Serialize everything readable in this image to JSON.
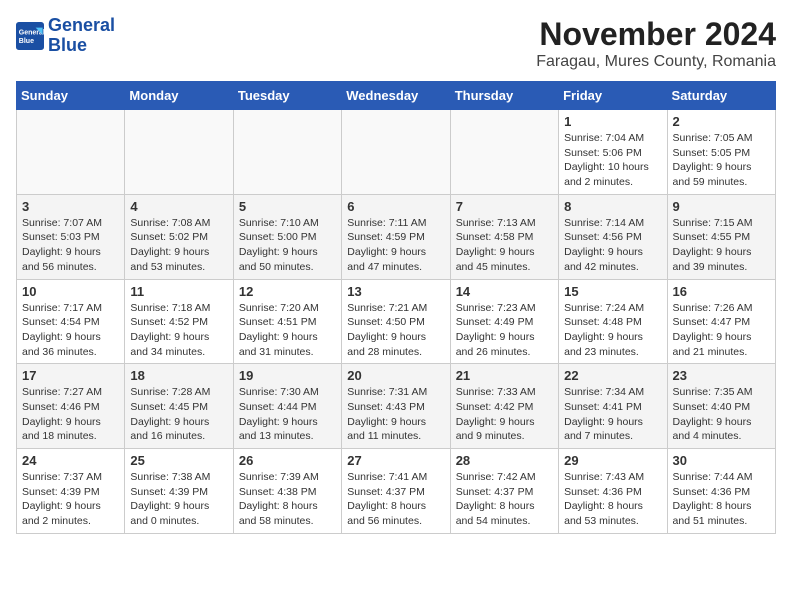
{
  "header": {
    "logo_line1": "General",
    "logo_line2": "Blue",
    "month": "November 2024",
    "location": "Faragau, Mures County, Romania"
  },
  "weekdays": [
    "Sunday",
    "Monday",
    "Tuesday",
    "Wednesday",
    "Thursday",
    "Friday",
    "Saturday"
  ],
  "weeks": [
    [
      {
        "day": "",
        "info": ""
      },
      {
        "day": "",
        "info": ""
      },
      {
        "day": "",
        "info": ""
      },
      {
        "day": "",
        "info": ""
      },
      {
        "day": "",
        "info": ""
      },
      {
        "day": "1",
        "info": "Sunrise: 7:04 AM\nSunset: 5:06 PM\nDaylight: 10 hours\nand 2 minutes."
      },
      {
        "day": "2",
        "info": "Sunrise: 7:05 AM\nSunset: 5:05 PM\nDaylight: 9 hours\nand 59 minutes."
      }
    ],
    [
      {
        "day": "3",
        "info": "Sunrise: 7:07 AM\nSunset: 5:03 PM\nDaylight: 9 hours\nand 56 minutes."
      },
      {
        "day": "4",
        "info": "Sunrise: 7:08 AM\nSunset: 5:02 PM\nDaylight: 9 hours\nand 53 minutes."
      },
      {
        "day": "5",
        "info": "Sunrise: 7:10 AM\nSunset: 5:00 PM\nDaylight: 9 hours\nand 50 minutes."
      },
      {
        "day": "6",
        "info": "Sunrise: 7:11 AM\nSunset: 4:59 PM\nDaylight: 9 hours\nand 47 minutes."
      },
      {
        "day": "7",
        "info": "Sunrise: 7:13 AM\nSunset: 4:58 PM\nDaylight: 9 hours\nand 45 minutes."
      },
      {
        "day": "8",
        "info": "Sunrise: 7:14 AM\nSunset: 4:56 PM\nDaylight: 9 hours\nand 42 minutes."
      },
      {
        "day": "9",
        "info": "Sunrise: 7:15 AM\nSunset: 4:55 PM\nDaylight: 9 hours\nand 39 minutes."
      }
    ],
    [
      {
        "day": "10",
        "info": "Sunrise: 7:17 AM\nSunset: 4:54 PM\nDaylight: 9 hours\nand 36 minutes."
      },
      {
        "day": "11",
        "info": "Sunrise: 7:18 AM\nSunset: 4:52 PM\nDaylight: 9 hours\nand 34 minutes."
      },
      {
        "day": "12",
        "info": "Sunrise: 7:20 AM\nSunset: 4:51 PM\nDaylight: 9 hours\nand 31 minutes."
      },
      {
        "day": "13",
        "info": "Sunrise: 7:21 AM\nSunset: 4:50 PM\nDaylight: 9 hours\nand 28 minutes."
      },
      {
        "day": "14",
        "info": "Sunrise: 7:23 AM\nSunset: 4:49 PM\nDaylight: 9 hours\nand 26 minutes."
      },
      {
        "day": "15",
        "info": "Sunrise: 7:24 AM\nSunset: 4:48 PM\nDaylight: 9 hours\nand 23 minutes."
      },
      {
        "day": "16",
        "info": "Sunrise: 7:26 AM\nSunset: 4:47 PM\nDaylight: 9 hours\nand 21 minutes."
      }
    ],
    [
      {
        "day": "17",
        "info": "Sunrise: 7:27 AM\nSunset: 4:46 PM\nDaylight: 9 hours\nand 18 minutes."
      },
      {
        "day": "18",
        "info": "Sunrise: 7:28 AM\nSunset: 4:45 PM\nDaylight: 9 hours\nand 16 minutes."
      },
      {
        "day": "19",
        "info": "Sunrise: 7:30 AM\nSunset: 4:44 PM\nDaylight: 9 hours\nand 13 minutes."
      },
      {
        "day": "20",
        "info": "Sunrise: 7:31 AM\nSunset: 4:43 PM\nDaylight: 9 hours\nand 11 minutes."
      },
      {
        "day": "21",
        "info": "Sunrise: 7:33 AM\nSunset: 4:42 PM\nDaylight: 9 hours\nand 9 minutes."
      },
      {
        "day": "22",
        "info": "Sunrise: 7:34 AM\nSunset: 4:41 PM\nDaylight: 9 hours\nand 7 minutes."
      },
      {
        "day": "23",
        "info": "Sunrise: 7:35 AM\nSunset: 4:40 PM\nDaylight: 9 hours\nand 4 minutes."
      }
    ],
    [
      {
        "day": "24",
        "info": "Sunrise: 7:37 AM\nSunset: 4:39 PM\nDaylight: 9 hours\nand 2 minutes."
      },
      {
        "day": "25",
        "info": "Sunrise: 7:38 AM\nSunset: 4:39 PM\nDaylight: 9 hours\nand 0 minutes."
      },
      {
        "day": "26",
        "info": "Sunrise: 7:39 AM\nSunset: 4:38 PM\nDaylight: 8 hours\nand 58 minutes."
      },
      {
        "day": "27",
        "info": "Sunrise: 7:41 AM\nSunset: 4:37 PM\nDaylight: 8 hours\nand 56 minutes."
      },
      {
        "day": "28",
        "info": "Sunrise: 7:42 AM\nSunset: 4:37 PM\nDaylight: 8 hours\nand 54 minutes."
      },
      {
        "day": "29",
        "info": "Sunrise: 7:43 AM\nSunset: 4:36 PM\nDaylight: 8 hours\nand 53 minutes."
      },
      {
        "day": "30",
        "info": "Sunrise: 7:44 AM\nSunset: 4:36 PM\nDaylight: 8 hours\nand 51 minutes."
      }
    ]
  ]
}
